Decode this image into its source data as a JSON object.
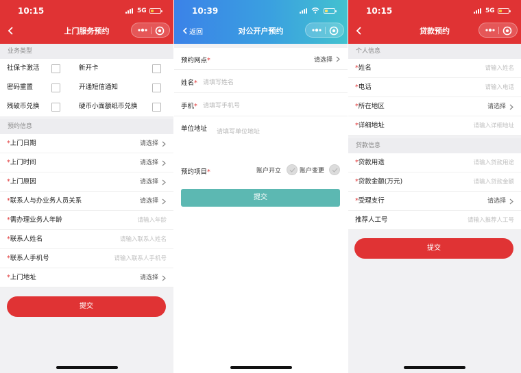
{
  "screen1": {
    "status": {
      "time": "10:15",
      "network": "5G"
    },
    "title": "上门服务预约",
    "section_business": "业务类型",
    "checkboxes": [
      {
        "label": "社保卡激活"
      },
      {
        "label": "新开卡"
      },
      {
        "label": "密码重置"
      },
      {
        "label": "开通短信通知"
      },
      {
        "label": "残破币兑换"
      },
      {
        "label": "硬币小面额纸币兑换"
      }
    ],
    "section_booking": "预约信息",
    "rows": [
      {
        "required": "*",
        "label": "上门日期",
        "value": "请选择"
      },
      {
        "required": "*",
        "label": "上门时间",
        "value": "请选择"
      },
      {
        "required": "*",
        "label": "上门原因",
        "value": "请选择"
      },
      {
        "required": "*",
        "label": "联系人与办业务人员关系",
        "value": "请选择"
      },
      {
        "required": "*",
        "label": "需办理业务人年龄",
        "placeholder": "请输入年龄"
      },
      {
        "required": "*",
        "label": "联系人姓名",
        "placeholder": "请输入联系人姓名"
      },
      {
        "required": "*",
        "label": "联系人手机号",
        "placeholder": "请输入联系人手机号"
      },
      {
        "required": "*",
        "label": "上门地址",
        "value": "请选择"
      }
    ],
    "submit": "提交"
  },
  "screen2": {
    "status": {
      "time": "10:39"
    },
    "back_label": "返回",
    "title": "对公开户预约",
    "branch": {
      "label": "预约网点",
      "required": "*",
      "value": "请选择"
    },
    "name": {
      "label": "姓名",
      "required": "*",
      "placeholder": "请填写姓名"
    },
    "phone": {
      "label": "手机",
      "required": "*",
      "placeholder": "请填写手机号"
    },
    "address": {
      "label": "单位地址",
      "placeholder": "请填写单位地址"
    },
    "project": {
      "label": "预约项目",
      "required": "*",
      "option1": "账户开立",
      "option2": "账户变更"
    },
    "submit": "提交"
  },
  "screen3": {
    "status": {
      "time": "10:15",
      "network": "5G"
    },
    "title": "贷款预约",
    "section_personal": "个人信息",
    "personal_rows": [
      {
        "required": "*",
        "label": "姓名",
        "placeholder": "请输入姓名"
      },
      {
        "required": "*",
        "label": "电话",
        "placeholder": "请输入电话"
      },
      {
        "required": "*",
        "label": "所在地区",
        "value": "请选择"
      },
      {
        "required": "*",
        "label": "详细地址",
        "placeholder": "请输入详细地址"
      }
    ],
    "section_loan": "贷款信息",
    "loan_rows": [
      {
        "required": "*",
        "label": "贷款用途",
        "placeholder": "请输入贷款用途"
      },
      {
        "required": "*",
        "label": "贷款金额(万元)",
        "placeholder": "请输入贷款金额"
      },
      {
        "required": "*",
        "label": "受理支行",
        "value": "请选择"
      },
      {
        "required": "",
        "label": "推荐人工号",
        "placeholder": "请输入推荐人工号"
      }
    ],
    "submit": "提交"
  },
  "colors": {
    "brand_red": "#e03334",
    "submit_teal": "#5cb8b2",
    "blue_start": "#3b82e8",
    "blue_end": "#43c2cf"
  },
  "icons": [
    "back-icon",
    "more-icon",
    "close-target-icon",
    "chevron-right-icon",
    "checkbox-icon",
    "radio-check-icon",
    "signal-icon",
    "wifi-icon",
    "battery-icon"
  ]
}
